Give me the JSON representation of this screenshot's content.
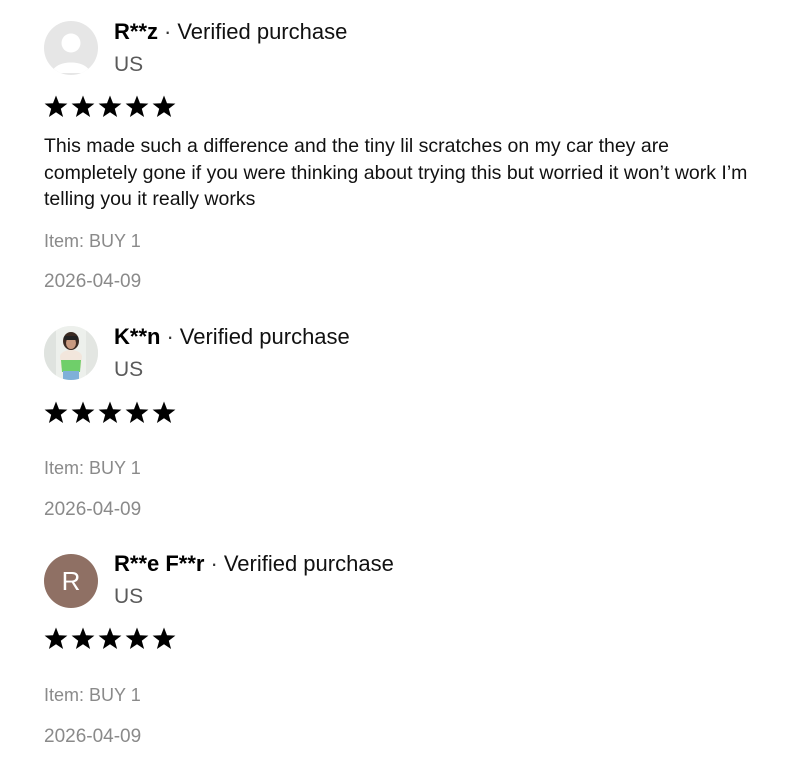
{
  "reviews": [
    {
      "reviewer": "R**z",
      "separator": "·",
      "verified_label": "Verified purchase",
      "country": "US",
      "rating": 5,
      "text": "This made such a difference and the tiny lil scratches on my car they are completely gone if you were thinking about trying this but worried it won’t work I’m telling you it really works",
      "item_label": "Item:",
      "item_value": "BUY 1",
      "date": "2026-04-09",
      "avatar_type": "default-person-icon"
    },
    {
      "reviewer": "K**n",
      "separator": "·",
      "verified_label": "Verified purchase",
      "country": "US",
      "rating": 5,
      "text": "",
      "item_label": "Item:",
      "item_value": "BUY 1",
      "date": "2026-04-09",
      "avatar_type": "photo"
    },
    {
      "reviewer": "R**e F**r",
      "separator": "·",
      "verified_label": "Verified purchase",
      "country": "US",
      "rating": 5,
      "text": "",
      "item_label": "Item:",
      "item_value": "BUY 1",
      "date": "2026-04-09",
      "avatar_type": "letter",
      "avatar_letter": "R",
      "avatar_color": "#8f7064"
    }
  ],
  "colors": {
    "star": "#000000",
    "muted_text": "#8a8a8a"
  }
}
